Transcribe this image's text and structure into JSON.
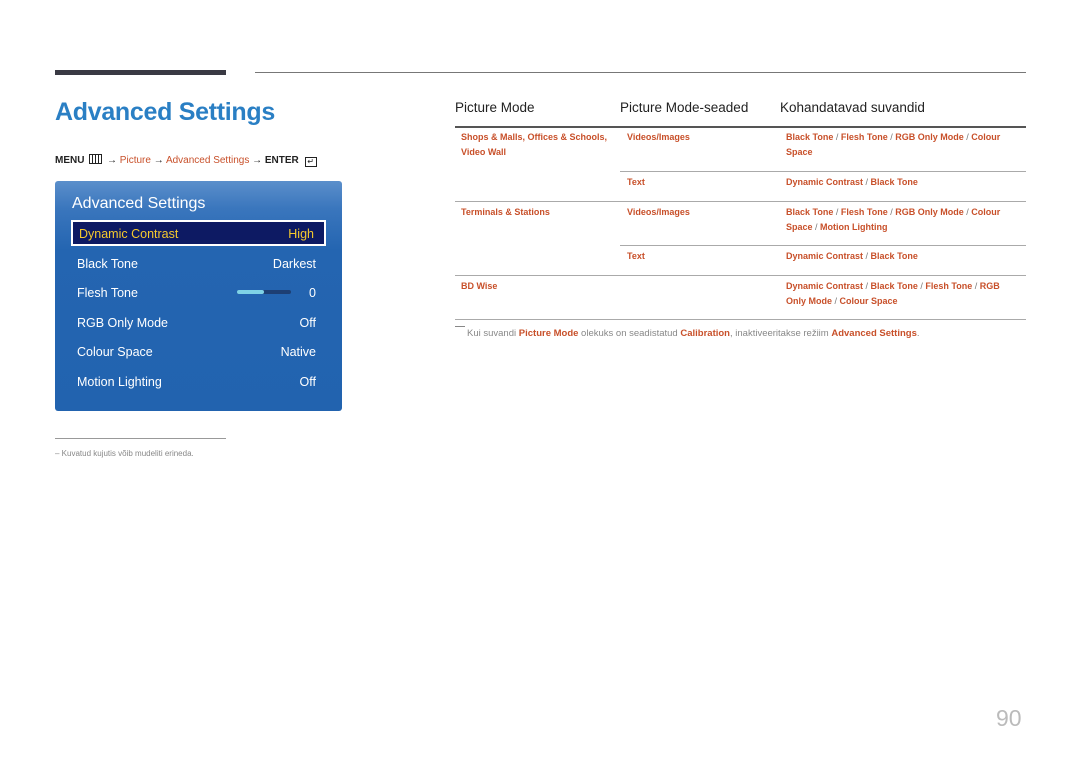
{
  "header": {
    "title": "Advanced Settings"
  },
  "breadcrumb": {
    "menu": "MENU",
    "menu_icon": "menu-grid-icon",
    "arrow": "→",
    "picture": "Picture",
    "advanced": "Advanced Settings",
    "enter": "ENTER",
    "enter_icon": "enter-icon",
    "enter_glyph": "↵"
  },
  "osd": {
    "title": "Advanced Settings",
    "accent_color": "#f5c92e",
    "items": [
      {
        "label": "Dynamic Contrast",
        "value": "High",
        "selected": true
      },
      {
        "label": "Black Tone",
        "value": "Darkest"
      },
      {
        "label": "Flesh Tone",
        "value": "0",
        "slider_fraction": 0.5
      },
      {
        "label": "RGB Only Mode",
        "value": "Off"
      },
      {
        "label": "Colour Space",
        "value": "Native"
      },
      {
        "label": "Motion Lighting",
        "value": "Off"
      }
    ]
  },
  "footnote": "–  Kuvatud kujutis võib mudeliti erineda.",
  "table": {
    "headers": [
      "Picture Mode",
      "Picture Mode-seaded",
      "Kohandatavad suvandid"
    ],
    "rows": [
      {
        "mode": "Shops & Malls, Offices & Schools, Video Wall",
        "setting": "Videos/Images",
        "options": [
          "Black Tone",
          "Flesh Tone",
          "RGB Only Mode",
          "Colour Space"
        ]
      },
      {
        "mode": "",
        "setting": "Text",
        "options": [
          "Dynamic Contrast",
          "Black Tone"
        ]
      },
      {
        "mode": "Terminals & Stations",
        "setting": "Videos/Images",
        "options": [
          "Black Tone",
          "Flesh Tone",
          "RGB Only Mode",
          "Colour Space",
          "Motion Lighting"
        ]
      },
      {
        "mode": "",
        "setting": "Text",
        "options": [
          "Dynamic Contrast",
          "Black Tone"
        ]
      },
      {
        "mode": "BD Wise",
        "setting": "",
        "options": [
          "Dynamic Contrast",
          "Black Tone",
          "Flesh Tone",
          "RGB Only Mode",
          "Colour Space"
        ]
      }
    ]
  },
  "note": {
    "part1": "Kui suvandi ",
    "b1": "Picture Mode",
    "part2": " olekuks on seadistatud ",
    "b2": "Calibration",
    "part3": ", inaktiveeritakse režiim ",
    "b3": "Advanced Settings",
    "part4": "."
  },
  "page_number": "90",
  "colors": {
    "title_blue": "#2a7fc4",
    "link_orange": "#c8502a"
  }
}
